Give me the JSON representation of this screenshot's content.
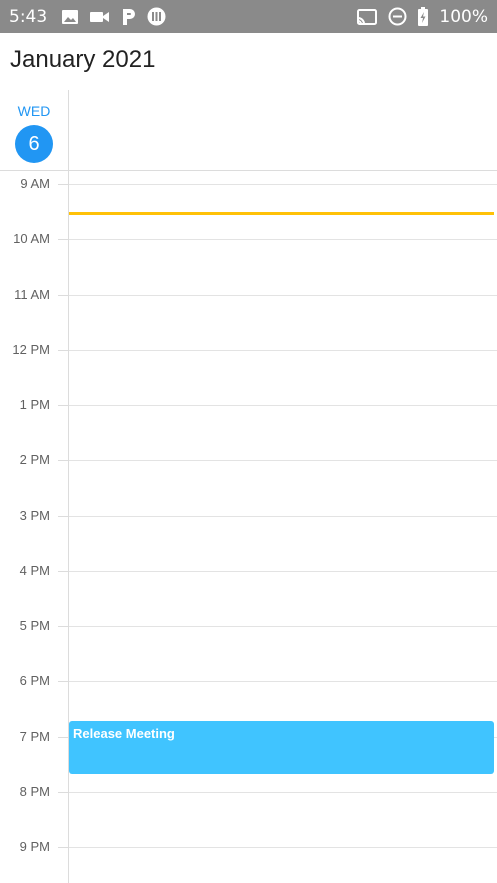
{
  "status_bar": {
    "time": "5:43",
    "left_icons": [
      "image-icon",
      "video-camera-icon",
      "parking-app-icon",
      "app-notification-icon"
    ],
    "right_icons": [
      "cast-icon",
      "do-not-disturb-icon",
      "battery-charging-icon"
    ],
    "battery": "100%"
  },
  "header": {
    "title": "January 2021"
  },
  "day": {
    "name": "WED",
    "number": "6"
  },
  "hours": [
    "9 AM",
    "10 AM",
    "11 AM",
    "12 PM",
    "1 PM",
    "2 PM",
    "3 PM",
    "4 PM",
    "5 PM",
    "6 PM",
    "7 PM",
    "8 PM",
    "9 PM"
  ],
  "events": [
    {
      "title": "Release Meeting",
      "start": "6:45 PM",
      "end": "7:45 PM"
    }
  ],
  "current_time": "9:30 AM",
  "colors": {
    "status_bar": "#8a8a8a",
    "accent": "#2196f3",
    "event": "#40c4ff",
    "now_line": "#ffc107"
  }
}
